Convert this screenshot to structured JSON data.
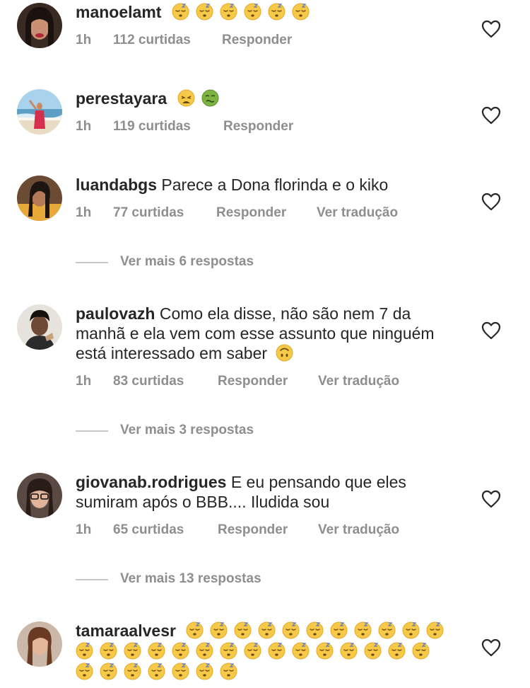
{
  "comments": [
    {
      "username": "manoelamt",
      "text": "",
      "emojis": [
        "sleeping-face",
        "sleeping-face",
        "sleeping-face",
        "sleeping-face",
        "sleeping-face",
        "sleeping-face"
      ],
      "time": "1h",
      "likes": "112 curtidas",
      "reply": "Responder",
      "translate": ""
    },
    {
      "username": "perestayara",
      "text": "",
      "emojis": [
        "weary-face",
        "nauseated-face"
      ],
      "time": "1h",
      "likes": "119 curtidas",
      "reply": "Responder",
      "translate": ""
    },
    {
      "username": "luandabgs",
      "text": "Parece a Dona florinda e o kiko",
      "emojis": [],
      "time": "1h",
      "likes": "77 curtidas",
      "reply": "Responder",
      "translate": "Ver tradução"
    },
    {
      "username": "paulovazh",
      "text": "Como ela disse, não são nem 7 da manhã e ela vem com esse assunto que ninguém está interessado em saber",
      "emojis": [
        "upside-down-face"
      ],
      "time": "1h",
      "likes": "83 curtidas",
      "reply": "Responder",
      "translate": "Ver tradução"
    },
    {
      "username": "giovanab.rodrigues",
      "text": "E eu pensando que eles sumiram após o BBB.... Iludida sou",
      "emojis": [],
      "time": "1h",
      "likes": "65 curtidas",
      "reply": "Responder",
      "translate": "Ver tradução"
    },
    {
      "username": "tamaraalvesr",
      "text": "",
      "emojis": [
        "sleeping-face",
        "sleeping-face",
        "sleeping-face",
        "sleeping-face",
        "sleeping-face",
        "sleeping-face",
        "sleeping-face",
        "sleeping-face",
        "sleeping-face",
        "sleeping-face",
        "sleeping-face",
        "sleeping-face",
        "sleeping-face",
        "sleeping-face",
        "sleeping-face",
        "sleeping-face",
        "sleeping-face",
        "sleeping-face",
        "sleeping-face",
        "sleeping-face",
        "sleeping-face",
        "sleeping-face",
        "sleeping-face",
        "sleeping-face",
        "sleeping-face",
        "sleeping-face",
        "sleeping-face",
        "sleeping-face",
        "sleeping-face",
        "sleeping-face",
        "sleeping-face",
        "sleeping-face",
        "sleeping-face"
      ],
      "time": "",
      "likes": "",
      "reply": "",
      "translate": ""
    }
  ],
  "view_more": [
    {
      "label": "Ver mais 6 respostas"
    },
    {
      "label": "Ver mais 3 respostas"
    },
    {
      "label": "Ver mais 13 respostas"
    }
  ],
  "icons": {
    "like": "heart-outline-icon"
  },
  "colors": {
    "text": "#262626",
    "secondary": "#8e8e8e",
    "divider": "#c7c7c7",
    "background": "#ffffff"
  }
}
